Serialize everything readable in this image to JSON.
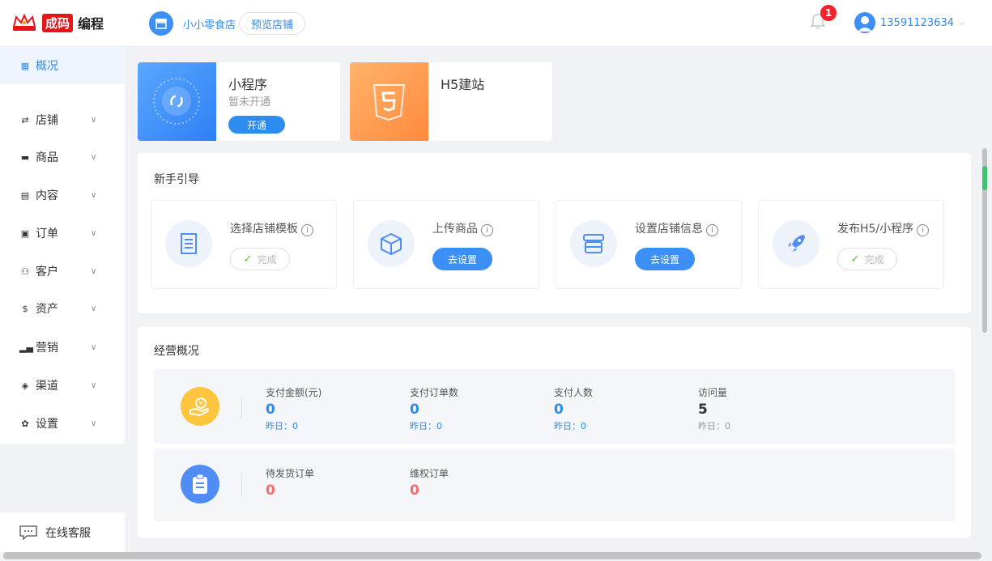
{
  "header": {
    "brand_tag": "成码",
    "brand_rest": "编程",
    "shop_name": "小小零食店",
    "preview_label": "预览店铺",
    "notification_count": "1",
    "user_phone": "13591123634"
  },
  "sidebar": {
    "items": [
      {
        "label": "概况",
        "icon": "grid-icon"
      },
      {
        "label": "店铺",
        "icon": "store-icon"
      },
      {
        "label": "商品",
        "icon": "goods-icon"
      },
      {
        "label": "内容",
        "icon": "content-icon"
      },
      {
        "label": "订单",
        "icon": "order-icon"
      },
      {
        "label": "客户",
        "icon": "customer-icon"
      },
      {
        "label": "资产",
        "icon": "dollar-icon"
      },
      {
        "label": "营销",
        "icon": "chart-icon"
      },
      {
        "label": "渠道",
        "icon": "layers-icon"
      },
      {
        "label": "设置",
        "icon": "gear-icon"
      }
    ],
    "service_label": "在线客服"
  },
  "cards": {
    "miniprogram": {
      "title": "小程序",
      "status": "暂未开通",
      "button": "开通"
    },
    "h5": {
      "title": "H5建站"
    }
  },
  "guide": {
    "title": "新手引导",
    "steps": [
      {
        "label": "选择店铺模板",
        "action": "完成"
      },
      {
        "label": "上传商品",
        "action": "去设置"
      },
      {
        "label": "设置店铺信息",
        "action": "去设置"
      },
      {
        "label": "发布H5/小程序",
        "action": "完成"
      }
    ]
  },
  "overview": {
    "title": "经营概况",
    "row1": [
      {
        "label": "支付金额(元)",
        "value": "0",
        "sub": "昨日：0"
      },
      {
        "label": "支付订单数",
        "value": "0",
        "sub": "昨日：0"
      },
      {
        "label": "支付人数",
        "value": "0",
        "sub": "昨日：0"
      },
      {
        "label": "访问量",
        "value": "5",
        "sub": "昨日：0"
      }
    ],
    "row2": [
      {
        "label": "待发货订单",
        "value": "0"
      },
      {
        "label": "维权订单",
        "value": "0"
      }
    ]
  },
  "colors": {
    "accent": "#2d8cf0",
    "warning": "#ffc53d",
    "danger": "#f56c6c",
    "badge": "#f5222d"
  }
}
